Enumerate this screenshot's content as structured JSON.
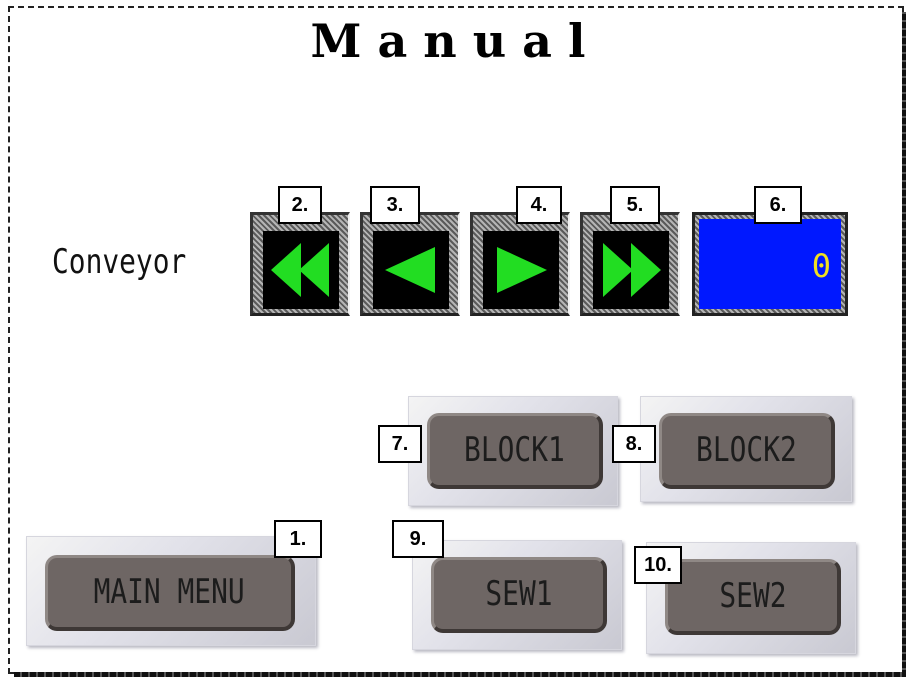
{
  "screen": {
    "title": "Manual"
  },
  "conveyor": {
    "label": "Conveyor",
    "buttons": [
      {
        "name": "fast-reverse",
        "icon": "double-left-arrow-icon"
      },
      {
        "name": "reverse",
        "icon": "left-arrow-icon"
      },
      {
        "name": "forward",
        "icon": "right-arrow-icon"
      },
      {
        "name": "fast-forward",
        "icon": "double-right-arrow-icon"
      }
    ],
    "display_value": "0",
    "arrow_color": "#22dd22",
    "display_color": "#0018ff",
    "value_color": "#f0e020"
  },
  "buttons": {
    "main_menu": "MAIN MENU",
    "block1": "BLOCK1",
    "block2": "BLOCK2",
    "sew1": "SEW1",
    "sew2": "SEW2"
  },
  "callouts": [
    "1.",
    "2.",
    "3.",
    "4.",
    "5.",
    "6.",
    "7.",
    "8.",
    "9.",
    "10."
  ]
}
